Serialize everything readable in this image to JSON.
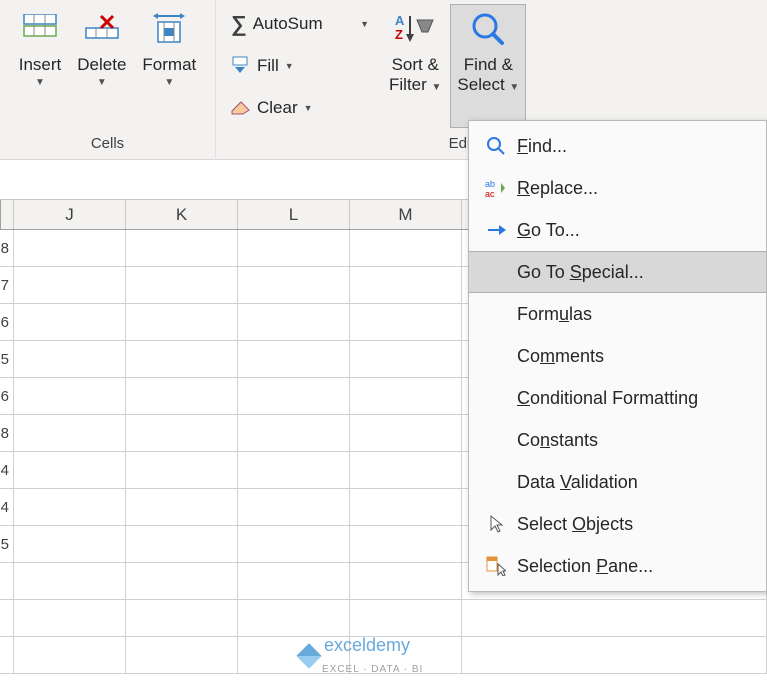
{
  "ribbon": {
    "cells_group_label": "Cells",
    "editing_group_label": "Editing",
    "insert": "Insert",
    "delete": "Delete",
    "format": "Format",
    "autosum": "AutoSum",
    "fill": "Fill",
    "clear": "Clear",
    "sort_filter_line1": "Sort &",
    "sort_filter_line2": "Filter",
    "find_select_line1": "Find &",
    "find_select_line2": "Select"
  },
  "menu": {
    "find": "Find...",
    "replace": "Replace...",
    "goto": "Go To...",
    "gotospecial": "Go To Special...",
    "formulas": "Formulas",
    "comments": "Comments",
    "cond_format": "Conditional Formatting",
    "constants": "Constants",
    "data_validation": "Data Validation",
    "select_objects": "Select Objects",
    "selection_pane": "Selection Pane..."
  },
  "columns": {
    "partial": "",
    "J": "J",
    "K": "K",
    "L": "L",
    "M": "M"
  },
  "partial_col_values": [
    "8",
    "7",
    "6",
    "5",
    "6",
    "8",
    "4",
    "4",
    "5",
    "",
    "",
    ""
  ],
  "watermark": {
    "brand": "exceldemy",
    "tagline": "EXCEL · DATA · BI"
  }
}
